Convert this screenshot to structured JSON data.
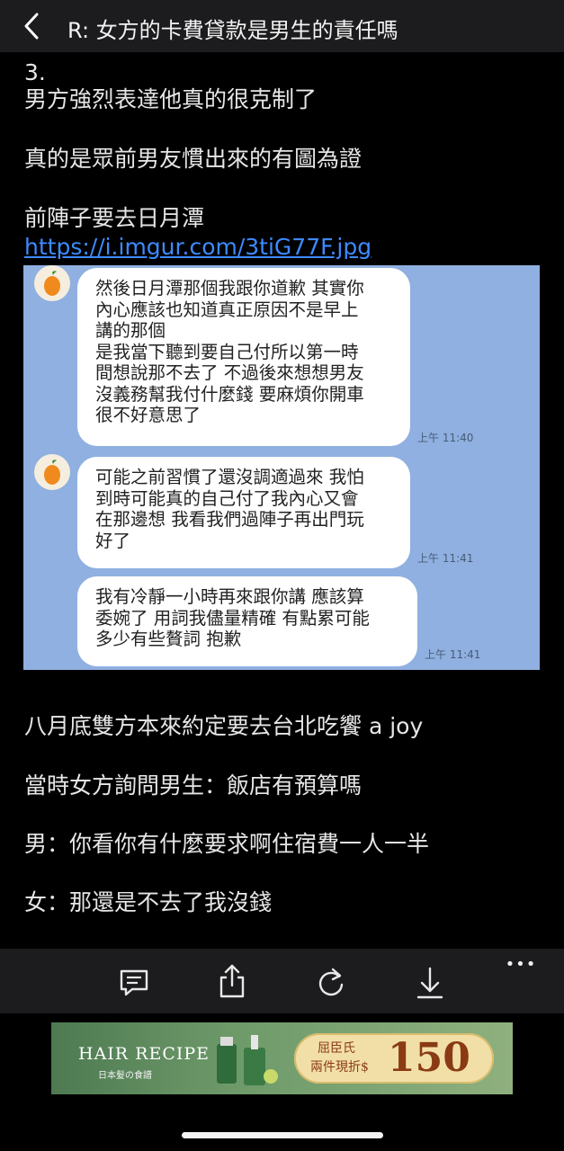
{
  "header": {
    "title": "R: 女方的卡費貸款是男生的責任嗎"
  },
  "post": {
    "line1": "3.",
    "line2": "男方強烈表達他真的很克制了",
    "line3": "真的是眾前男友慣出來的有圖為證",
    "line4": "前陣子要去日月潭",
    "link": "https://i.imgur.com/3tiG77F.jpg",
    "after1": "八月底雙方本來約定要去台北吃饗 a joy",
    "after2": "當時女方詢問男生：飯店有預算嗎",
    "after3": "男：你看你有什麼要求啊住宿費一人一半",
    "after4": "女：那還是不去了我沒錢"
  },
  "chat": {
    "msg1": {
      "lines": [
        "然後日月潭那個我跟你道歉 其實你",
        "內心應該也知道真正原因不是早上",
        "講的那個",
        "是我當下聽到要自己付所以第一時",
        "間想說那不去了 不過後來想想男友",
        "沒義務幫我付什麼錢 要麻煩你開車",
        "很不好意思了"
      ],
      "time": "上午 11:40"
    },
    "msg2": {
      "lines": [
        "可能之前習慣了還沒調適過來 我怕",
        "到時可能真的自己付了我內心又會",
        "在那邊想 我看我們過陣子再出門玩",
        "好了"
      ],
      "time": "上午 11:41"
    },
    "msg3": {
      "lines": [
        "我有冷靜一小時再來跟你講 應該算",
        "委婉了 用詞我儘量精確 有點累可能",
        "多少有些贅詞 抱歉"
      ],
      "time": "上午 11:41"
    }
  },
  "toolbar": {
    "more_label": "•••",
    "icons": [
      "comment-icon",
      "share-icon",
      "refresh-icon",
      "download-icon",
      "more-icon"
    ]
  },
  "ad": {
    "brand": "HAIR RECIPE",
    "brand_sub": "日本髮の食譜",
    "offer_line1": "屈臣氏",
    "offer_line2": "兩件現折$",
    "offer_amount": "150"
  },
  "colors": {
    "accent_link": "#3d8bff",
    "chat_bg": "#8fb0e0",
    "header_bg": "#1c1c1e"
  }
}
